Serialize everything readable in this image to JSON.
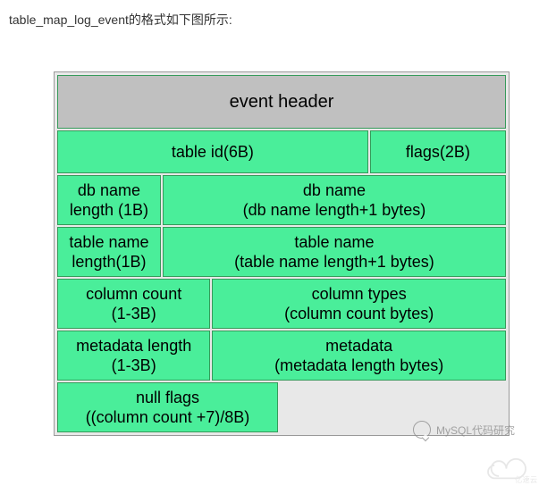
{
  "caption": "table_map_log_event的格式如下图所示:",
  "header": {
    "label": "event header"
  },
  "row1": {
    "table_id": "table id(6B)",
    "flags": "flags(2B)"
  },
  "row2": {
    "db_name_len_l1": "db name",
    "db_name_len_l2": "length (1B)",
    "db_name_l1": "db name",
    "db_name_l2": "(db name length+1 bytes)"
  },
  "row3": {
    "tbl_name_len_l1": "table name",
    "tbl_name_len_l2": "length(1B)",
    "tbl_name_l1": "table name",
    "tbl_name_l2": "(table name length+1 bytes)"
  },
  "row4": {
    "col_count_l1": "column count",
    "col_count_l2": "(1-3B)",
    "col_types_l1": "column types",
    "col_types_l2": "(column count bytes)"
  },
  "row5": {
    "meta_len_l1": "metadata length",
    "meta_len_l2": "(1-3B)",
    "meta_l1": "metadata",
    "meta_l2": "(metadata length bytes)"
  },
  "row6": {
    "null_flags_l1": "null flags",
    "null_flags_l2": "((column count +7)/8B)"
  },
  "watermark": {
    "text": "MySQL代码研究",
    "logo": "亿速云"
  },
  "chart_data": {
    "type": "table",
    "title": "table_map_log_event format",
    "rows": [
      [
        {
          "field": "event header",
          "size": "",
          "span": 1.0
        }
      ],
      [
        {
          "field": "table id",
          "size": "6B",
          "span": 0.7
        },
        {
          "field": "flags",
          "size": "2B",
          "span": 0.3
        }
      ],
      [
        {
          "field": "db name length",
          "size": "1B",
          "span": 0.25
        },
        {
          "field": "db name",
          "size": "db name length+1 bytes",
          "span": 0.75
        }
      ],
      [
        {
          "field": "table name length",
          "size": "1B",
          "span": 0.25
        },
        {
          "field": "table name",
          "size": "table name length+1 bytes",
          "span": 0.75
        }
      ],
      [
        {
          "field": "column count",
          "size": "1-3B",
          "span": 0.35
        },
        {
          "field": "column types",
          "size": "column count bytes",
          "span": 0.65
        }
      ],
      [
        {
          "field": "metadata length",
          "size": "1-3B",
          "span": 0.35
        },
        {
          "field": "metadata",
          "size": "metadata length bytes",
          "span": 0.65
        }
      ],
      [
        {
          "field": "null flags",
          "size": "(column count +7)/8B",
          "span": 0.5
        }
      ]
    ]
  }
}
